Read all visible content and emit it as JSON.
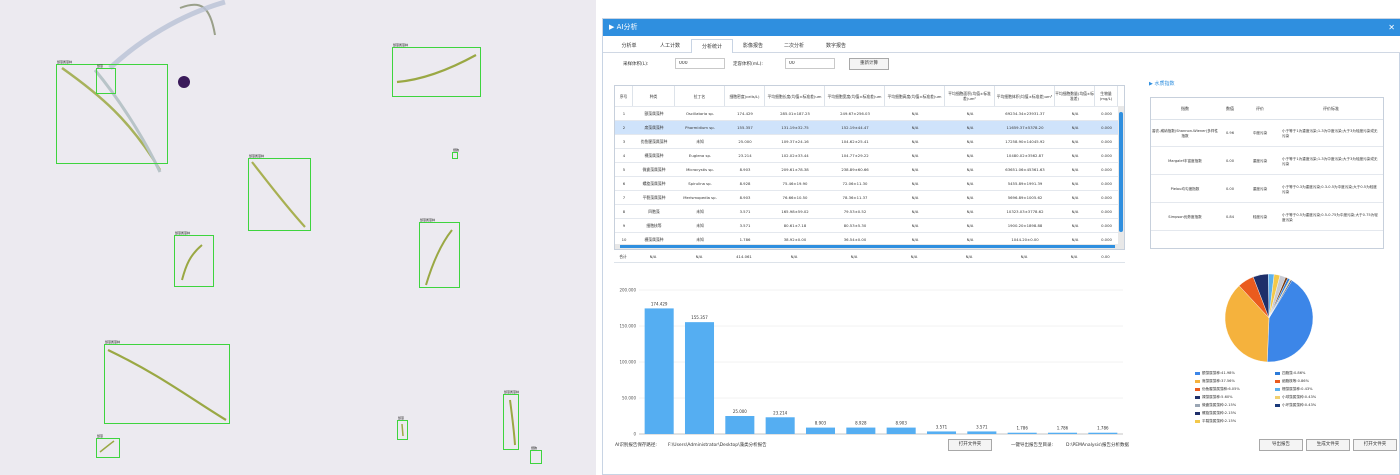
{
  "window": {
    "title": "AI分析",
    "close": "✕"
  },
  "tabs": [
    "分析单",
    "人工计数",
    "分析统计",
    "影像报告",
    "二次分析",
    "数字报告"
  ],
  "active_tab": 2,
  "params": {
    "sample_label": "采样体积(L):",
    "sample_value": "000",
    "conc_label": "定容体积(mL):",
    "conc_value": "00",
    "recalc_button": "重新计算"
  },
  "table": {
    "headers": [
      "序号",
      "种类",
      "拉丁名",
      "细胞密度(cells/L)",
      "平均细胞长度(均值±标准差)um",
      "平均细胞宽度(均值±标准差)um",
      "平均细胞高度(均值±标准差)um",
      "平均细胞面积(均值±标准差)um²",
      "平均细胞体积(均值±标准差)um³",
      "平均细胞数量(均值±标准差)",
      "生物量(mg/L)"
    ],
    "rows": [
      [
        "1",
        "颤藻属藻种",
        "Oscillatoria sp.",
        "174.429",
        "285.01±187.25",
        "249.67±256.03",
        "N/A",
        "N/A",
        "69234.34±23931.37",
        "N/A",
        "0.000"
      ],
      [
        "2",
        "席藻属藻种",
        "Phormidium sp.",
        "155.357",
        "131.19±32.75",
        "152.19±44.47",
        "N/A",
        "N/A",
        "11659.37±5378.20",
        "N/A",
        "0.000"
      ],
      [
        "3",
        "伪鱼腥藻属藻种",
        "未知",
        "25.000",
        "109.37±24.16",
        "104.62±25.41",
        "N/A",
        "N/A",
        "17258.90±14045.92",
        "N/A",
        "0.000"
      ],
      [
        "4",
        "裸藻属藻种",
        "Euglena sp.",
        "23.214",
        "102.02±33.44",
        "104.77±29.22",
        "N/A",
        "N/A",
        "10480.02±3562.87",
        "N/A",
        "0.000"
      ],
      [
        "5",
        "微囊藻属藻种",
        "Microcystis sp.",
        "8.903",
        "209.61±78.38",
        "238.89±60.66",
        "N/A",
        "N/A",
        "63651.06±45361.63",
        "N/A",
        "0.000"
      ],
      [
        "6",
        "螺旋藻属藻种",
        "Spirulina sp.",
        "8.928",
        "75.46±19.90",
        "72.06±11.30",
        "N/A",
        "N/A",
        "5455.89±1991.39",
        "N/A",
        "0.000"
      ],
      [
        "7",
        "平裂藻属藻种",
        "Merismopedia sp.",
        "8.903",
        "76.66±10.50",
        "78.36±11.37",
        "N/A",
        "N/A",
        "5696.89±1005.62",
        "N/A",
        "0.000"
      ],
      [
        "8",
        "四胞藻",
        "未知",
        "3.571",
        "165.98±59.02",
        "79.53±0.52",
        "N/A",
        "N/A",
        "10323.03±3778.62",
        "N/A",
        "0.000"
      ],
      [
        "9",
        "细胞核等",
        "未知",
        "3.571",
        "80.61±7.18",
        "80.53±5.30",
        "N/A",
        "N/A",
        "1900.20±1898.88",
        "N/A",
        "0.000"
      ],
      [
        "10",
        "栅藻属藻种",
        "未知",
        "1.786",
        "38.92±0.00",
        "36.54±0.00",
        "N/A",
        "N/A",
        "1044.20±0.00",
        "N/A",
        "0.000"
      ]
    ],
    "summary": [
      "合计",
      "N/A",
      "N/A",
      "414.061",
      "N/A",
      "N/A",
      "N/A",
      "N/A",
      "N/A",
      "N/A",
      "0.00"
    ]
  },
  "chart_data": {
    "type": "bar",
    "categories": [
      "颤藻属藻种",
      "席藻属藻种",
      "伪鱼腥藻属藻种",
      "裸藻属藻种",
      "微囊藻属藻种",
      "螺旋藻属藻种",
      "平裂藻属藻种",
      "四胞藻",
      "细胞核等",
      "栅藻属藻种",
      "小球藻属藻种",
      "小环藻属藻种"
    ],
    "values": [
      174.429,
      155.357,
      25.0,
      23.214,
      8.903,
      8.928,
      8.903,
      3.571,
      3.571,
      1.786,
      1.786,
      1.786
    ],
    "value_labels": [
      "174.429",
      "155.357",
      "25.000",
      "23.214",
      "8.903",
      "8.928",
      "8.903",
      "3.571",
      "3.571",
      "1.786",
      "1.786",
      "1.786"
    ],
    "ylim": [
      0,
      200
    ],
    "yticks": [
      "0",
      "50.000",
      "100.000",
      "150.000",
      "200.000"
    ],
    "color": "#55aef2"
  },
  "footer": {
    "path_label": "AI识别报告保存路径:",
    "path_value": "F:\\Users\\Administrator\\Desktop\\藻类分析报告",
    "open_button": "打开文件夹",
    "report_label": "一键导出报告至目录:",
    "report_value": "D:\\PEMAnalysis\\报告分析数据",
    "btn_export": "导出报告",
    "btn_create": "生成文件夹",
    "btn_open": "打开文件夹"
  },
  "eval": {
    "header": "水质指数",
    "columns": [
      "指数",
      "数值",
      "评价",
      "评价标准"
    ],
    "rows": [
      [
        "香农-威纳指数(Shannon-Wiener)多样性指数",
        "0.96",
        "中度污染",
        "小于等于1为重度污染;1-3为中度污染;大于3为轻度污染或无污染"
      ],
      [
        "Margalef丰富度指数",
        "0.00",
        "重度污染",
        "小于等于1为重度污染;1-3为中度污染;大于3为轻度污染或无污染"
      ],
      [
        "Pielou均匀度指数",
        "0.00",
        "重度污染",
        "小于等于0.3为重度污染;0.3-0.5为中度污染;大于0.5为轻度污染"
      ],
      [
        "Simpson优势度指数",
        "0.84",
        "轻度污染",
        "小于等于0.5为重度污染;0.5-0.75为中度污染;大于0.75为轻度污染"
      ]
    ]
  },
  "pie": {
    "values": [
      41.98,
      37.56,
      6.05,
      5.6,
      2.15,
      2.15,
      2.15,
      0.86,
      0.86,
      0.43,
      0.43
    ],
    "colors": [
      "#3c86e8",
      "#f5b23d",
      "#ea5b1e",
      "#1e2f6a",
      "#5ab0ee",
      "#f3c84a",
      "#c8cad2",
      "#7a3c10",
      "#2c7bd9",
      "#f1d070",
      "#1b3a7a"
    ],
    "legend": [
      "颤藻属藻种:41.98%",
      "席藻属藻种:37.56%",
      "伪鱼腥藻属藻种:6.05%",
      "裸藻属藻种:5.60%",
      "微囊藻属藻种:2.15%",
      "螺旋藻属藻种:2.15%",
      "平裂藻属藻种:2.15%",
      "四胞藻:0.86%",
      "细胞核等:0.86%",
      "栅藻属藻种:0.43%",
      "小球藻属藻种:0.43%",
      "小环藻属藻种:0.43%"
    ],
    "legend_colors": [
      "#3c86e8",
      "#f5b23d",
      "#ea5b1e",
      "#1e2f6a",
      "#9aa6b4",
      "#1e2f6a",
      "#f3c84a",
      "#2c7bd9",
      "#ea5b1e",
      "#5ab0ee",
      "#f1d070",
      "#1b3a7a"
    ]
  },
  "micro": {
    "labels": [
      "颤藻属藻种",
      "颤藻",
      "颤藻属藻种",
      "细胞",
      "颤藻属藻种",
      "颤藻属藻种",
      "颤藻属藻种",
      "颤藻属藻种",
      "颤藻属藻种",
      "细胞",
      "颤藻",
      "颤藻"
    ]
  }
}
